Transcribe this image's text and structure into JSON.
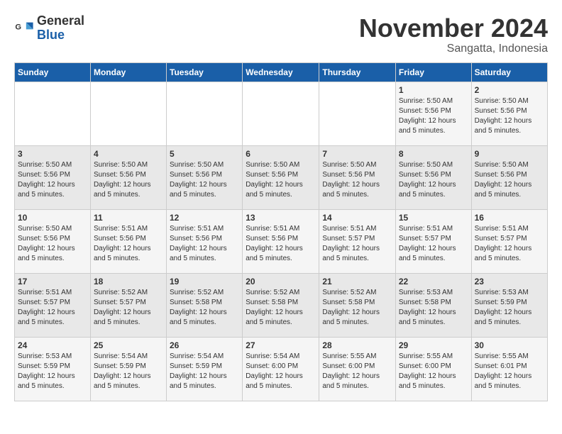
{
  "logo": {
    "line1": "General",
    "line2": "Blue"
  },
  "title": {
    "month": "November 2024",
    "location": "Sangatta, Indonesia"
  },
  "headers": [
    "Sunday",
    "Monday",
    "Tuesday",
    "Wednesday",
    "Thursday",
    "Friday",
    "Saturday"
  ],
  "weeks": [
    [
      {
        "day": "",
        "info": ""
      },
      {
        "day": "",
        "info": ""
      },
      {
        "day": "",
        "info": ""
      },
      {
        "day": "",
        "info": ""
      },
      {
        "day": "",
        "info": ""
      },
      {
        "day": "1",
        "info": "Sunrise: 5:50 AM\nSunset: 5:56 PM\nDaylight: 12 hours and 5 minutes."
      },
      {
        "day": "2",
        "info": "Sunrise: 5:50 AM\nSunset: 5:56 PM\nDaylight: 12 hours and 5 minutes."
      }
    ],
    [
      {
        "day": "3",
        "info": "Sunrise: 5:50 AM\nSunset: 5:56 PM\nDaylight: 12 hours and 5 minutes."
      },
      {
        "day": "4",
        "info": "Sunrise: 5:50 AM\nSunset: 5:56 PM\nDaylight: 12 hours and 5 minutes."
      },
      {
        "day": "5",
        "info": "Sunrise: 5:50 AM\nSunset: 5:56 PM\nDaylight: 12 hours and 5 minutes."
      },
      {
        "day": "6",
        "info": "Sunrise: 5:50 AM\nSunset: 5:56 PM\nDaylight: 12 hours and 5 minutes."
      },
      {
        "day": "7",
        "info": "Sunrise: 5:50 AM\nSunset: 5:56 PM\nDaylight: 12 hours and 5 minutes."
      },
      {
        "day": "8",
        "info": "Sunrise: 5:50 AM\nSunset: 5:56 PM\nDaylight: 12 hours and 5 minutes."
      },
      {
        "day": "9",
        "info": "Sunrise: 5:50 AM\nSunset: 5:56 PM\nDaylight: 12 hours and 5 minutes."
      }
    ],
    [
      {
        "day": "10",
        "info": "Sunrise: 5:50 AM\nSunset: 5:56 PM\nDaylight: 12 hours and 5 minutes."
      },
      {
        "day": "11",
        "info": "Sunrise: 5:51 AM\nSunset: 5:56 PM\nDaylight: 12 hours and 5 minutes."
      },
      {
        "day": "12",
        "info": "Sunrise: 5:51 AM\nSunset: 5:56 PM\nDaylight: 12 hours and 5 minutes."
      },
      {
        "day": "13",
        "info": "Sunrise: 5:51 AM\nSunset: 5:56 PM\nDaylight: 12 hours and 5 minutes."
      },
      {
        "day": "14",
        "info": "Sunrise: 5:51 AM\nSunset: 5:57 PM\nDaylight: 12 hours and 5 minutes."
      },
      {
        "day": "15",
        "info": "Sunrise: 5:51 AM\nSunset: 5:57 PM\nDaylight: 12 hours and 5 minutes."
      },
      {
        "day": "16",
        "info": "Sunrise: 5:51 AM\nSunset: 5:57 PM\nDaylight: 12 hours and 5 minutes."
      }
    ],
    [
      {
        "day": "17",
        "info": "Sunrise: 5:51 AM\nSunset: 5:57 PM\nDaylight: 12 hours and 5 minutes."
      },
      {
        "day": "18",
        "info": "Sunrise: 5:52 AM\nSunset: 5:57 PM\nDaylight: 12 hours and 5 minutes."
      },
      {
        "day": "19",
        "info": "Sunrise: 5:52 AM\nSunset: 5:58 PM\nDaylight: 12 hours and 5 minutes."
      },
      {
        "day": "20",
        "info": "Sunrise: 5:52 AM\nSunset: 5:58 PM\nDaylight: 12 hours and 5 minutes."
      },
      {
        "day": "21",
        "info": "Sunrise: 5:52 AM\nSunset: 5:58 PM\nDaylight: 12 hours and 5 minutes."
      },
      {
        "day": "22",
        "info": "Sunrise: 5:53 AM\nSunset: 5:58 PM\nDaylight: 12 hours and 5 minutes."
      },
      {
        "day": "23",
        "info": "Sunrise: 5:53 AM\nSunset: 5:59 PM\nDaylight: 12 hours and 5 minutes."
      }
    ],
    [
      {
        "day": "24",
        "info": "Sunrise: 5:53 AM\nSunset: 5:59 PM\nDaylight: 12 hours and 5 minutes."
      },
      {
        "day": "25",
        "info": "Sunrise: 5:54 AM\nSunset: 5:59 PM\nDaylight: 12 hours and 5 minutes."
      },
      {
        "day": "26",
        "info": "Sunrise: 5:54 AM\nSunset: 5:59 PM\nDaylight: 12 hours and 5 minutes."
      },
      {
        "day": "27",
        "info": "Sunrise: 5:54 AM\nSunset: 6:00 PM\nDaylight: 12 hours and 5 minutes."
      },
      {
        "day": "28",
        "info": "Sunrise: 5:55 AM\nSunset: 6:00 PM\nDaylight: 12 hours and 5 minutes."
      },
      {
        "day": "29",
        "info": "Sunrise: 5:55 AM\nSunset: 6:00 PM\nDaylight: 12 hours and 5 minutes."
      },
      {
        "day": "30",
        "info": "Sunrise: 5:55 AM\nSunset: 6:01 PM\nDaylight: 12 hours and 5 minutes."
      }
    ]
  ]
}
